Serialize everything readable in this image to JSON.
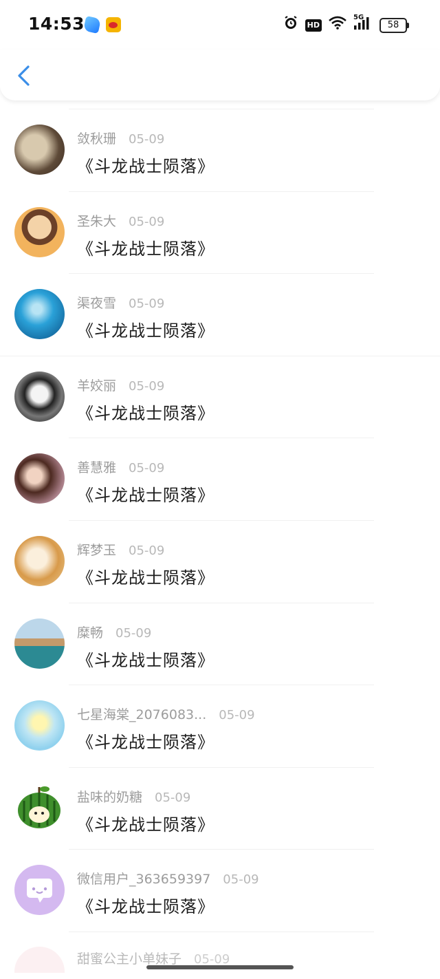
{
  "status_bar": {
    "time": "14:53",
    "network": "5G",
    "hd": "HD",
    "battery": "58"
  },
  "nav": {
    "back_icon": "chevron-left-icon",
    "accent_color": "#3a8ee8"
  },
  "comments": [
    {
      "name": "敛秋珊",
      "date": "05-09",
      "text": "《斗龙战士陨落》"
    },
    {
      "name": "圣朱大",
      "date": "05-09",
      "text": "《斗龙战士陨落》"
    },
    {
      "name": "渠夜雪",
      "date": "05-09",
      "text": "《斗龙战士陨落》"
    },
    {
      "name": "羊姣丽",
      "date": "05-09",
      "text": "《斗龙战士陨落》"
    },
    {
      "name": "善慧雅",
      "date": "05-09",
      "text": "《斗龙战士陨落》"
    },
    {
      "name": "辉梦玉",
      "date": "05-09",
      "text": "《斗龙战士陨落》"
    },
    {
      "name": "糜畅",
      "date": "05-09",
      "text": "《斗龙战士陨落》"
    },
    {
      "name": "七星海棠_2076083...",
      "date": "05-09",
      "text": "《斗龙战士陨落》"
    },
    {
      "name": "盐味的奶糖",
      "date": "05-09",
      "text": "《斗龙战士陨落》"
    },
    {
      "name": "微信用户_363659397",
      "date": "05-09",
      "text": "《斗龙战士陨落》"
    }
  ],
  "partial_comment": {
    "name": "甜蜜公主小单妹子",
    "date": "05-09"
  }
}
